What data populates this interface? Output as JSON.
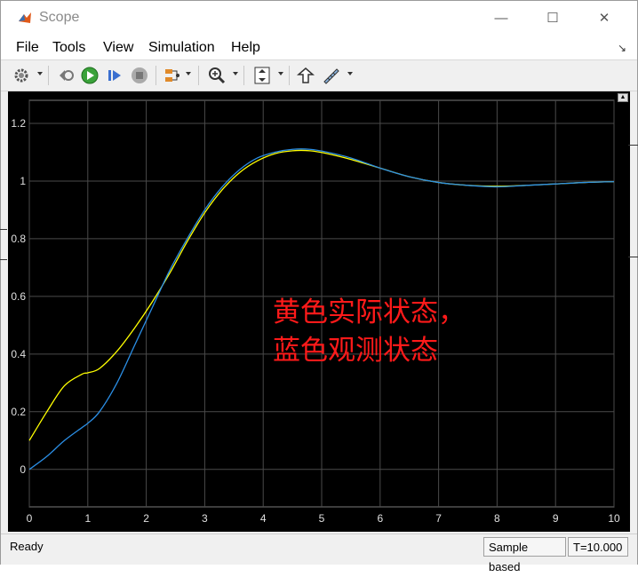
{
  "window": {
    "title": "Scope"
  },
  "menu": [
    "File",
    "Tools",
    "View",
    "Simulation",
    "Help"
  ],
  "toolbar": {
    "icons": [
      "gear-icon",
      "restore-icon",
      "run-icon",
      "step-forward-icon",
      "stop-icon",
      "signal-select-icon",
      "zoom-in-icon",
      "autoscale-icon",
      "highlight-icon",
      "measure-icon"
    ]
  },
  "chart_data": {
    "type": "line",
    "xlim": [
      0,
      10
    ],
    "ylim": [
      -0.13,
      1.28
    ],
    "xticks": [
      "0",
      "1",
      "2",
      "3",
      "4",
      "5",
      "6",
      "7",
      "8",
      "9",
      "10"
    ],
    "yticks": [
      "0",
      "0.2",
      "0.4",
      "0.6",
      "0.8",
      "1",
      "1.2"
    ],
    "grid": true,
    "series": [
      {
        "color": "#ffff00",
        "x": [
          0,
          0.3,
          0.6,
          0.9,
          1.0,
          1.2,
          1.5,
          1.8,
          2.1,
          2.4,
          2.7,
          3.0,
          3.3,
          3.6,
          3.9,
          4.2,
          4.5,
          4.8,
          5.1,
          5.5,
          6.0,
          6.5,
          7.0,
          7.5,
          8.0,
          8.5,
          9.0,
          9.5,
          10.0
        ],
        "y": [
          0.1,
          0.2,
          0.29,
          0.33,
          0.335,
          0.35,
          0.41,
          0.49,
          0.58,
          0.68,
          0.79,
          0.89,
          0.97,
          1.03,
          1.07,
          1.095,
          1.105,
          1.105,
          1.095,
          1.075,
          1.045,
          1.015,
          0.995,
          0.985,
          0.982,
          0.985,
          0.99,
          0.995,
          0.998
        ]
      },
      {
        "color": "#2b8fe6",
        "x": [
          0,
          0.3,
          0.6,
          0.9,
          1.0,
          1.2,
          1.5,
          1.8,
          2.1,
          2.4,
          2.7,
          3.0,
          3.3,
          3.6,
          3.9,
          4.2,
          4.5,
          4.8,
          5.1,
          5.5,
          6.0,
          6.5,
          7.0,
          7.5,
          8.0,
          8.5,
          9.0,
          9.5,
          10.0
        ],
        "y": [
          0.0,
          0.045,
          0.1,
          0.145,
          0.16,
          0.2,
          0.3,
          0.43,
          0.56,
          0.69,
          0.8,
          0.9,
          0.98,
          1.04,
          1.08,
          1.1,
          1.11,
          1.11,
          1.1,
          1.08,
          1.045,
          1.015,
          0.995,
          0.985,
          0.98,
          0.985,
          0.99,
          0.995,
          0.998
        ]
      }
    ]
  },
  "annotation": {
    "line1": "黄色实际状态，",
    "line2": "蓝色观测状态"
  },
  "status": {
    "ready": "Ready",
    "mode": "Sample based",
    "time": "T=10.000"
  }
}
